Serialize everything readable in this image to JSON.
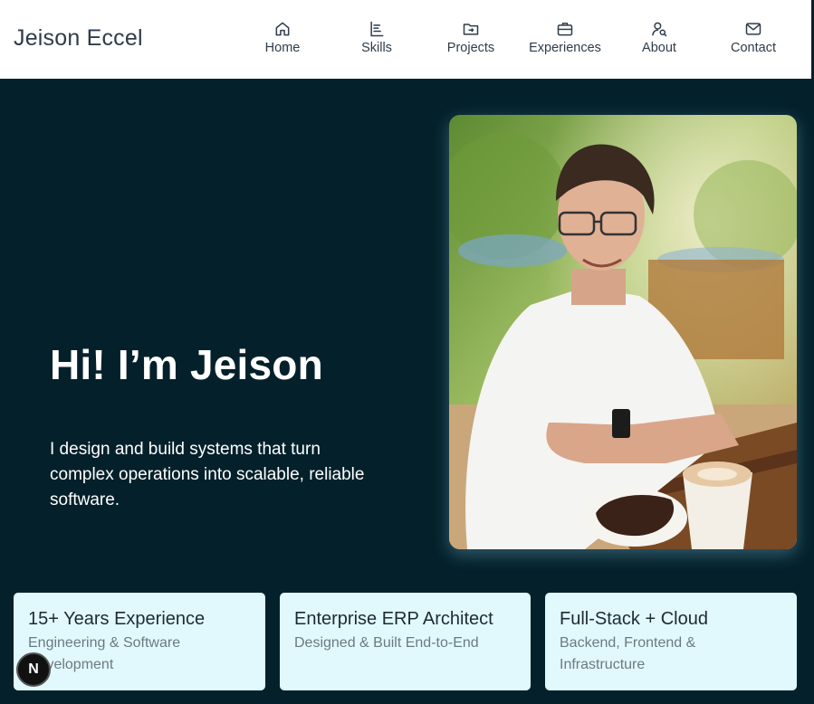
{
  "header": {
    "brand": "Jeison Eccel",
    "nav": [
      {
        "label": "Home",
        "icon": "home-icon"
      },
      {
        "label": "Skills",
        "icon": "skills-icon"
      },
      {
        "label": "Projects",
        "icon": "folder-icon"
      },
      {
        "label": "Experiences",
        "icon": "briefcase-icon"
      },
      {
        "label": "About",
        "icon": "user-search-icon"
      },
      {
        "label": "Contact",
        "icon": "mail-icon"
      }
    ]
  },
  "hero": {
    "title": "Hi! I’m Jeison",
    "description": "I design and build systems that turn complex operations into scalable, reliable software."
  },
  "cards": [
    {
      "title": "15+ Years Experience",
      "subtitle": "Engineering & Software Development"
    },
    {
      "title": "Enterprise ERP Architect",
      "subtitle": "Designed & Built End-to-End"
    },
    {
      "title": "Full-Stack + Cloud",
      "subtitle": "Backend, Frontend & Infrastructure"
    }
  ],
  "badge": {
    "letter": "N"
  },
  "colors": {
    "background": "#04212b",
    "card": "#e1f9fc",
    "header": "#ffffff",
    "nav_text": "#2f3c4a"
  }
}
